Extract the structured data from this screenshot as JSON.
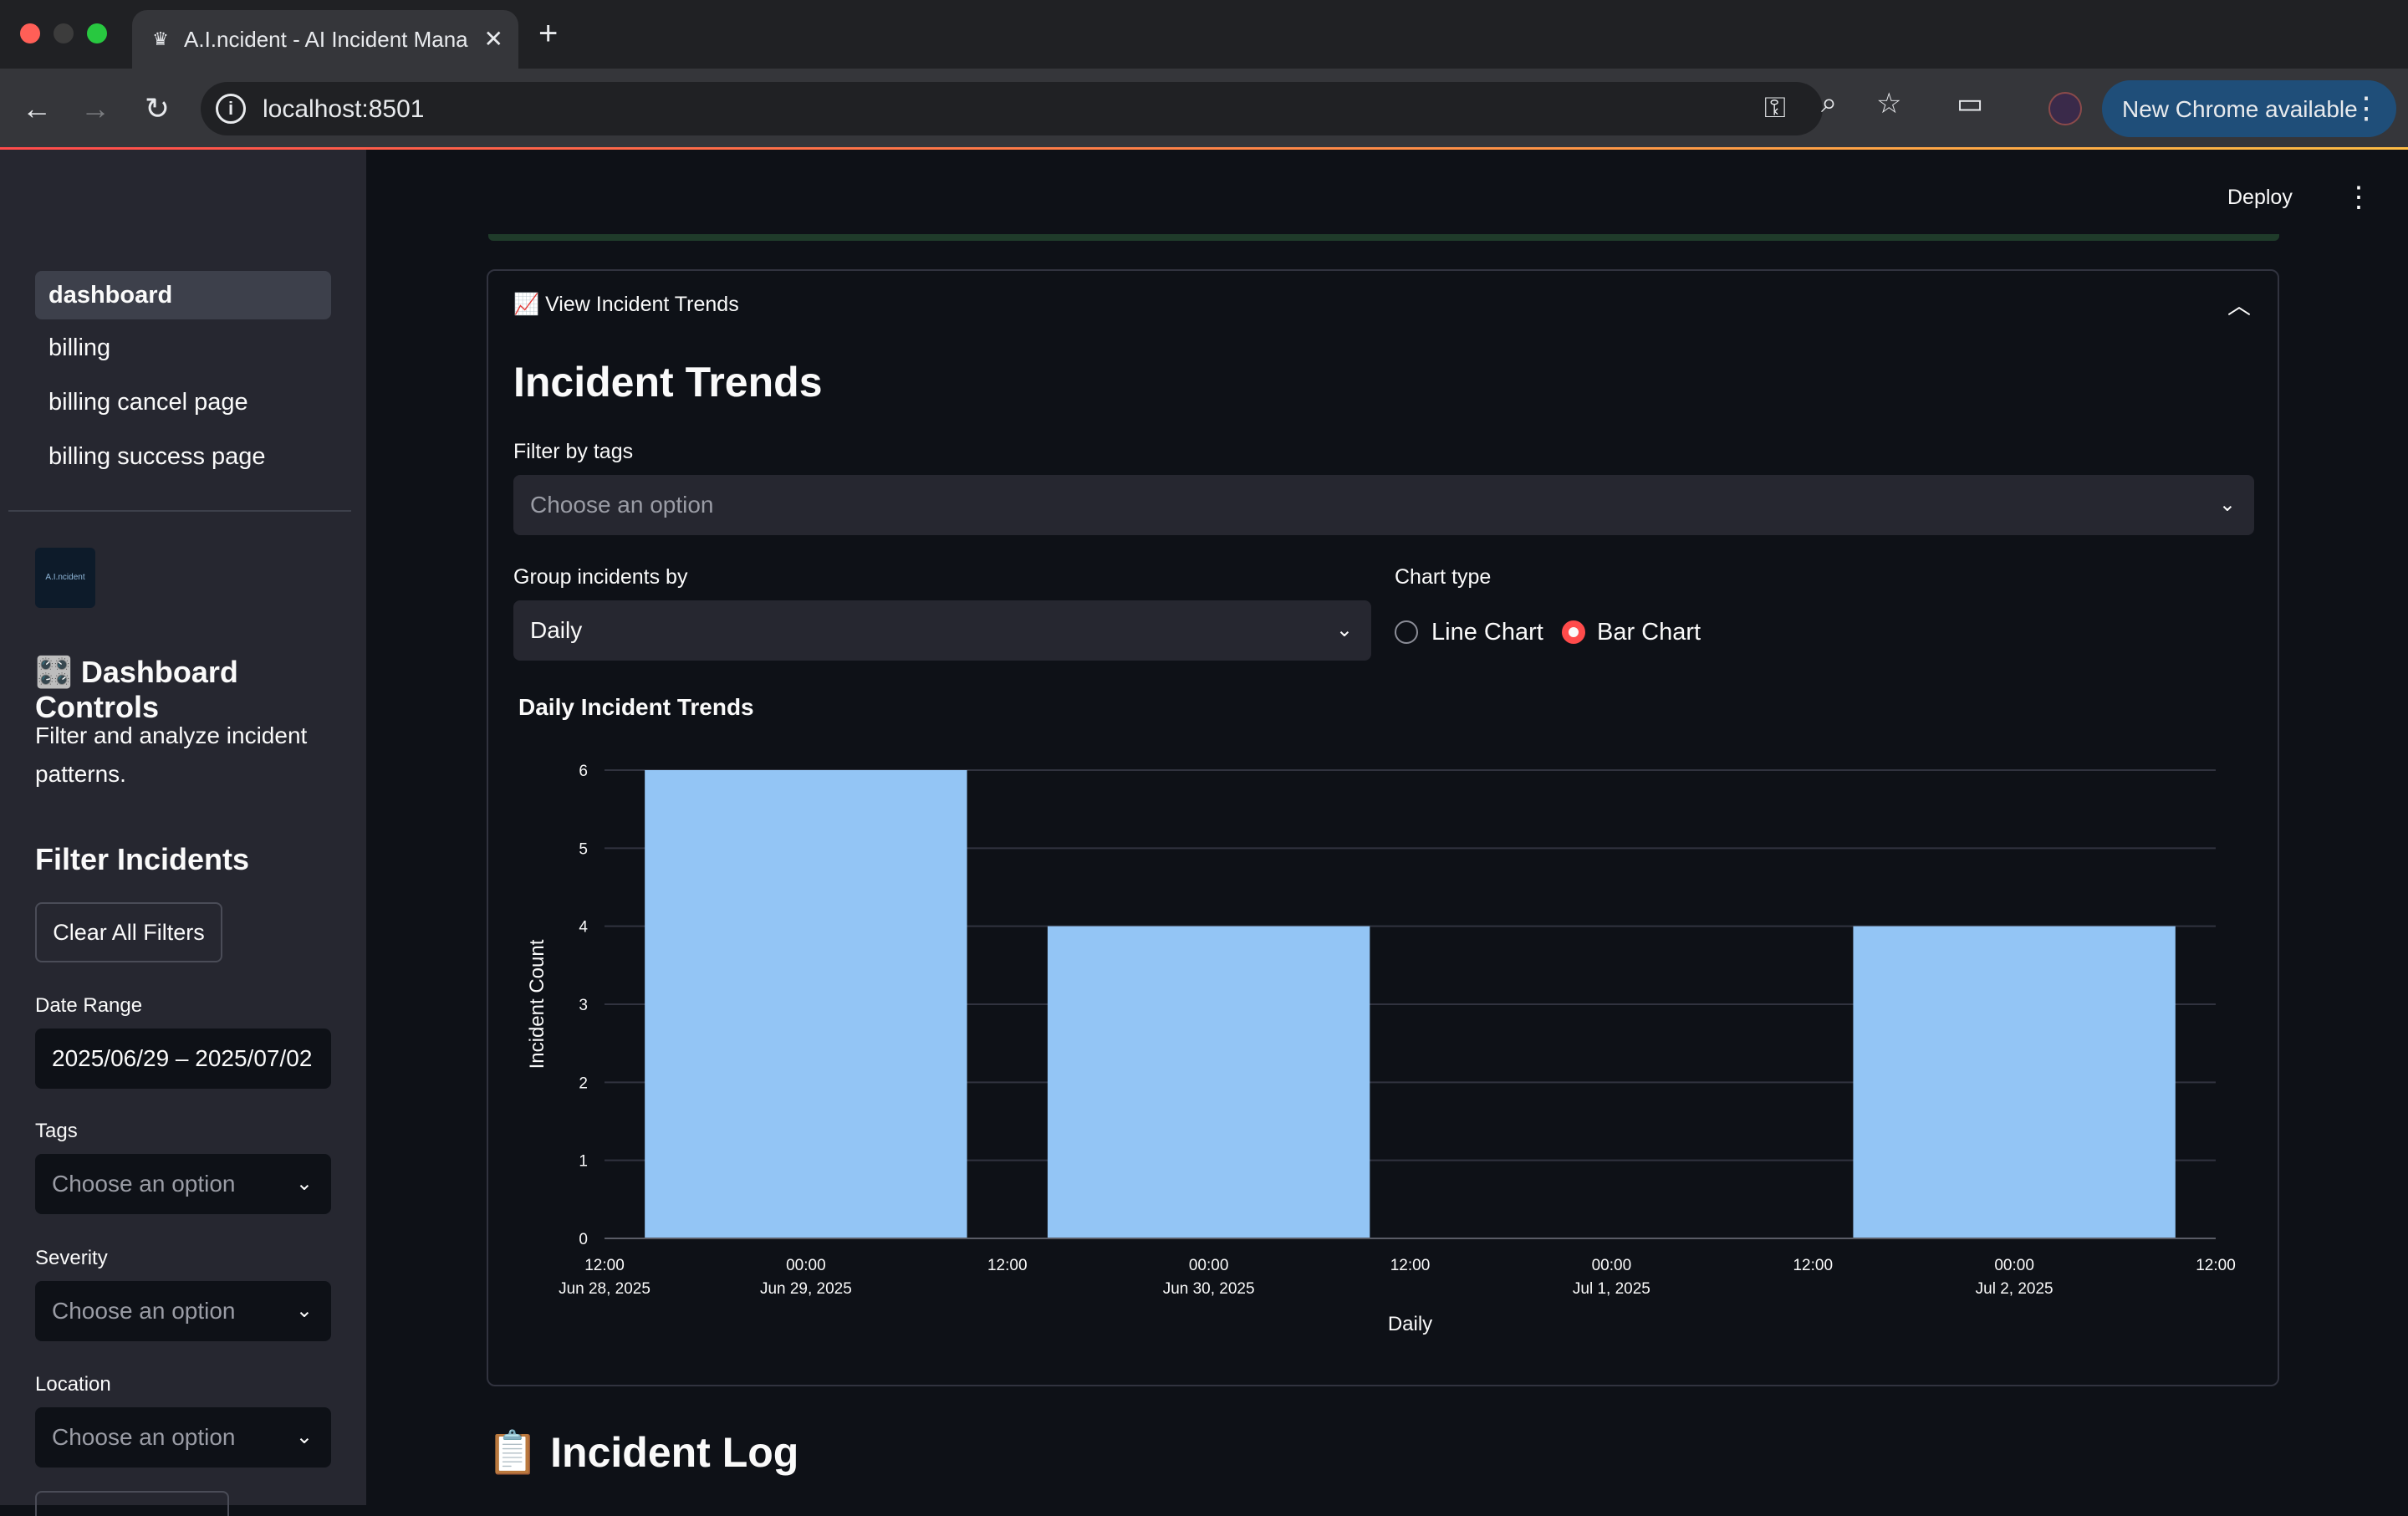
{
  "browser": {
    "tab_title": "A.I.ncident - AI Incident Mana",
    "url": "localhost:8501",
    "update_label": "New Chrome available",
    "icons": {
      "favicon": "crown-icon",
      "back": "back-arrow-icon",
      "forward": "forward-arrow-icon",
      "reload": "reload-icon",
      "info": "info-icon",
      "password": "key-icon",
      "zoom": "zoom-icon",
      "bookmark": "star-icon",
      "cast": "cast-icon",
      "menu": "more-vertical-icon"
    }
  },
  "sidebar": {
    "nav": [
      {
        "label": "dashboard",
        "active": true
      },
      {
        "label": "billing",
        "active": false
      },
      {
        "label": "billing cancel page",
        "active": false
      },
      {
        "label": "billing success page",
        "active": false
      }
    ],
    "logo_text": "A.I.ncident",
    "controls_title": "🎛️ Dashboard Controls",
    "controls_desc": "Filter and analyze incident patterns.",
    "filter_title": "Filter Incidents",
    "clear_label": "Clear All Filters",
    "date_label": "Date Range",
    "date_value": "2025/06/29 – 2025/07/02",
    "tags_label": "Tags",
    "tags_placeholder": "Choose an option",
    "severity_label": "Severity",
    "severity_placeholder": "Choose an option",
    "location_label": "Location",
    "location_placeholder": "Choose an option"
  },
  "header": {
    "deploy_label": "Deploy"
  },
  "main": {
    "expander_title": "📈 View Incident Trends",
    "heading": "Incident Trends",
    "filter_tags_label": "Filter by tags",
    "filter_tags_placeholder": "Choose an option",
    "group_label": "Group incidents by",
    "group_value": "Daily",
    "chart_type_label": "Chart type",
    "chart_type_options": [
      "Line Chart",
      "Bar Chart"
    ],
    "chart_type_selected": "Bar Chart",
    "log_heading": "📋 Incident Log"
  },
  "colors": {
    "accent": "#ff4b4b",
    "bar": "#93c5f5",
    "background": "#0e1117",
    "sidebar": "#262730"
  },
  "chart_data": {
    "type": "bar",
    "title": "Daily Incident Trends",
    "xlabel": "Daily",
    "ylabel": "Incident Count",
    "x": [
      "2025-06-29",
      "2025-06-30",
      "2025-07-01",
      "2025-07-02"
    ],
    "values": [
      6,
      4,
      0,
      4
    ],
    "ylim": [
      0,
      6
    ],
    "yticks": [
      0,
      1,
      2,
      3,
      4,
      5,
      6
    ],
    "xticks": [
      {
        "time": "12:00",
        "date": "Jun 28, 2025"
      },
      {
        "time": "00:00",
        "date": "Jun 29, 2025"
      },
      {
        "time": "12:00",
        "date": ""
      },
      {
        "time": "00:00",
        "date": "Jun 30, 2025"
      },
      {
        "time": "12:00",
        "date": ""
      },
      {
        "time": "00:00",
        "date": "Jul 1, 2025"
      },
      {
        "time": "12:00",
        "date": ""
      },
      {
        "time": "00:00",
        "date": "Jul 2, 2025"
      },
      {
        "time": "12:00",
        "date": ""
      }
    ],
    "grid": true
  }
}
